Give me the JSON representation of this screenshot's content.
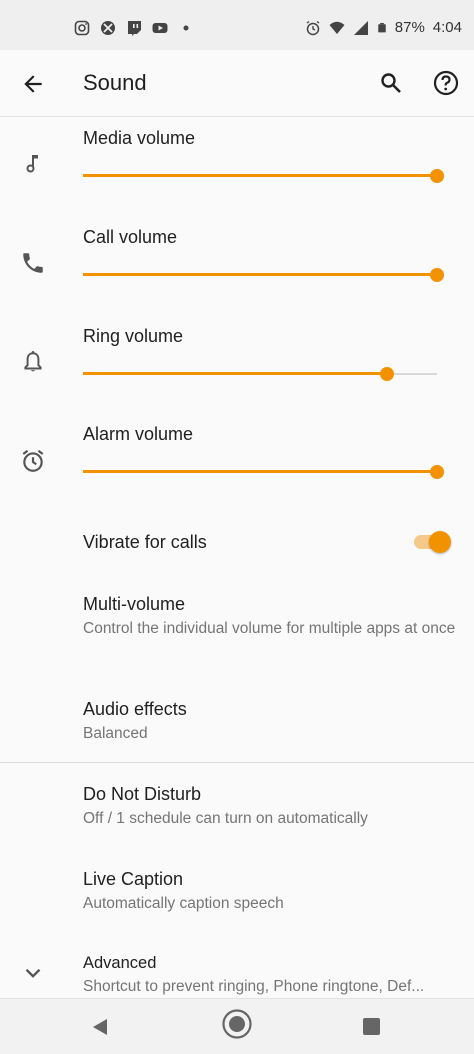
{
  "status_bar": {
    "battery": "87%",
    "time": "4:04",
    "left_icons": [
      "instagram-icon",
      "xbox-icon",
      "twitch-icon",
      "youtube-icon",
      "dot-icon"
    ],
    "right_icons": [
      "alarm-icon",
      "wifi-icon",
      "signal-icon",
      "battery-icon"
    ]
  },
  "app_bar": {
    "title": "Sound"
  },
  "sliders": [
    {
      "label": "Media volume",
      "icon": "music-note-icon",
      "level": 1.0
    },
    {
      "label": "Call volume",
      "icon": "phone-icon",
      "level": 1.0
    },
    {
      "label": "Ring volume",
      "icon": "bell-icon",
      "level": 0.86
    },
    {
      "label": "Alarm volume",
      "icon": "alarm-clock-icon",
      "level": 1.0
    }
  ],
  "vibrate": {
    "label": "Vibrate for calls",
    "on": true
  },
  "multi_volume": {
    "title": "Multi-volume",
    "summary": "Control the individual volume for multiple apps at once"
  },
  "audio_effects": {
    "title": "Audio effects",
    "summary": "Balanced"
  },
  "dnd": {
    "title": "Do Not Disturb",
    "summary": "Off / 1 schedule can turn on automatically"
  },
  "live_caption": {
    "title": "Live Caption",
    "summary": "Automatically caption speech"
  },
  "advanced": {
    "title": "Advanced",
    "summary": "Shortcut to prevent ringing, Phone ringtone, Def..."
  },
  "colors": {
    "accent": "#f39200",
    "background": "#fafafa"
  }
}
